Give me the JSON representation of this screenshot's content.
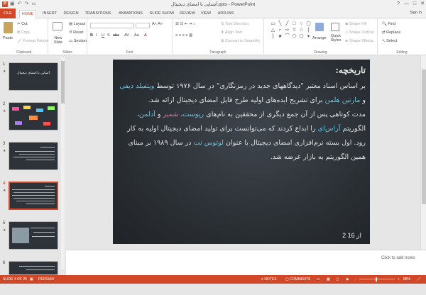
{
  "window": {
    "app_icon": "P",
    "title": "آشنایی با امضای دیجیتال.pptx - PowerPoint",
    "quick_access": [
      "save-icon",
      "undo-icon",
      "redo-icon",
      "start-slideshow-icon"
    ],
    "controls": [
      "?",
      "—",
      "□",
      "✕"
    ]
  },
  "tabs": [
    "FILE",
    "HOME",
    "INSERT",
    "DESIGN",
    "TRANSITIONS",
    "ANIMATIONS",
    "SLIDE SHOW",
    "REVIEW",
    "VIEW",
    "ADD-INS"
  ],
  "active_tab": "HOME",
  "account": "Sign in",
  "ribbon": {
    "clipboard": {
      "paste": "Paste",
      "cut": "Cut",
      "copy": "Copy",
      "format_painter": "Format Painter",
      "label": "Clipboard"
    },
    "slides": {
      "new_slide": "New Slide",
      "layout": "Layout",
      "reset": "Reset",
      "section": "Section",
      "label": "Slides"
    },
    "font": {
      "label": "Font",
      "format_buttons": [
        "B",
        "I",
        "U",
        "S",
        "abc",
        "AV",
        "Aa",
        "A"
      ]
    },
    "paragraph": {
      "text_direction": "Text Direction",
      "align_text": "Align Text",
      "convert_smartart": "Convert to SmartArt",
      "label": "Paragraph"
    },
    "drawing": {
      "arrange": "Arrange",
      "quick_styles": "Quick Styles",
      "shape_fill": "Shape Fill",
      "shape_outline": "Shape Outline",
      "shape_effects": "Shape Effects",
      "label": "Drawing"
    },
    "editing": {
      "find": "Find",
      "replace": "Replace",
      "select": "Select",
      "label": "Editing"
    }
  },
  "thumbnails": [
    {
      "number": "1",
      "title": "آشنایی با امضای دیجیتال"
    },
    {
      "number": "2"
    },
    {
      "number": "3"
    },
    {
      "number": "4",
      "active": true
    },
    {
      "number": "5"
    },
    {
      "number": "6"
    }
  ],
  "slide": {
    "title": "تاریخچه:",
    "p1_a": "بر اساس اسناد معتبر \"دیدگاههای جدید در رمزنگاری\" در سال ۱۹۷۶ توسط ",
    "p1_name1": "ویتفیلد دیفی",
    "p1_b": " و ",
    "p1_name2": "مارتین هلمن",
    "p1_c": " برای تشریح ایده‌های اولیه طرح فایل امضای دیجیتال ارائه شد.",
    "p2_a": "مدت کوتاهی پس از آن جمع دیگری از محققین به نام‌های ",
    "p2_name1": "ریوست",
    "p2_b": "، ",
    "p2_name2": "شمیر",
    "p2_c": " و ",
    "p2_name3": "آدلمن",
    "p2_d": "، الگوریتم ",
    "p2_name4": "آر‌اس‌ای",
    "p2_e": " را ابداع کردند که می‌توانست برای تولید امضای دیجیتال اولیه به کار رود. اول بسته نرم‌افزاری امضای دیجیتال با عنوان ",
    "p2_name5": "لوتوس نت",
    "p2_f": " در سال ۱۹۸۹ بر مبنای همین الگوریتم به بازار عرضه شد.",
    "page": "2 از 16"
  },
  "notes_placeholder": "Click to add notes",
  "status": {
    "slide_info": "SLIDE 4 OF 25",
    "language": "PERSIAN",
    "notes": "NOTES",
    "comments": "COMMENTS",
    "zoom": "88%"
  },
  "colors": {
    "accent": "#d24726",
    "slide_bg": "#2b3035",
    "highlight_blue": "#5fc7ea",
    "highlight_pink": "#ff5fa8"
  }
}
